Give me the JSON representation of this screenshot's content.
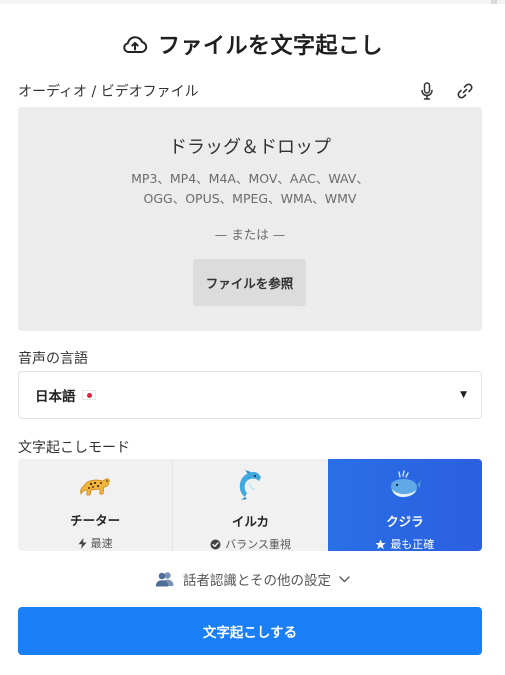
{
  "header": {
    "title": "ファイルを文字起こし",
    "icon": "cloud-upload-icon"
  },
  "source": {
    "label": "オーディオ / ビデオファイル",
    "icons": [
      "microphone-icon",
      "link-icon"
    ]
  },
  "dropzone": {
    "title": "ドラッグ＆ドロップ",
    "formats_line1": "MP3、MP4、M4A、MOV、AAC、WAV、",
    "formats_line2": "OGG、OPUS、MPEG、WMA、WMV",
    "or_text": "— または —",
    "browse_label": "ファイルを参照"
  },
  "language": {
    "label": "音声の言語",
    "selected": "日本語",
    "flag": "japan-flag-icon"
  },
  "mode": {
    "label": "文字起こしモード",
    "options": [
      {
        "name": "チーター",
        "sub": "最速",
        "icon": "cheetah-icon",
        "sub_icon": "lightning-icon",
        "active": false
      },
      {
        "name": "イルカ",
        "sub": "バランス重視",
        "icon": "dolphin-icon",
        "sub_icon": "check-circle-icon",
        "active": false
      },
      {
        "name": "クジラ",
        "sub": "最も正確",
        "icon": "whale-icon",
        "sub_icon": "star-icon",
        "active": true
      }
    ],
    "active_color": "#2a6fe6"
  },
  "speaker": {
    "label": "話者認識とその他の設定",
    "icon": "people-icon"
  },
  "submit": {
    "label": "文字起こしする",
    "color": "#1a7ef6"
  }
}
